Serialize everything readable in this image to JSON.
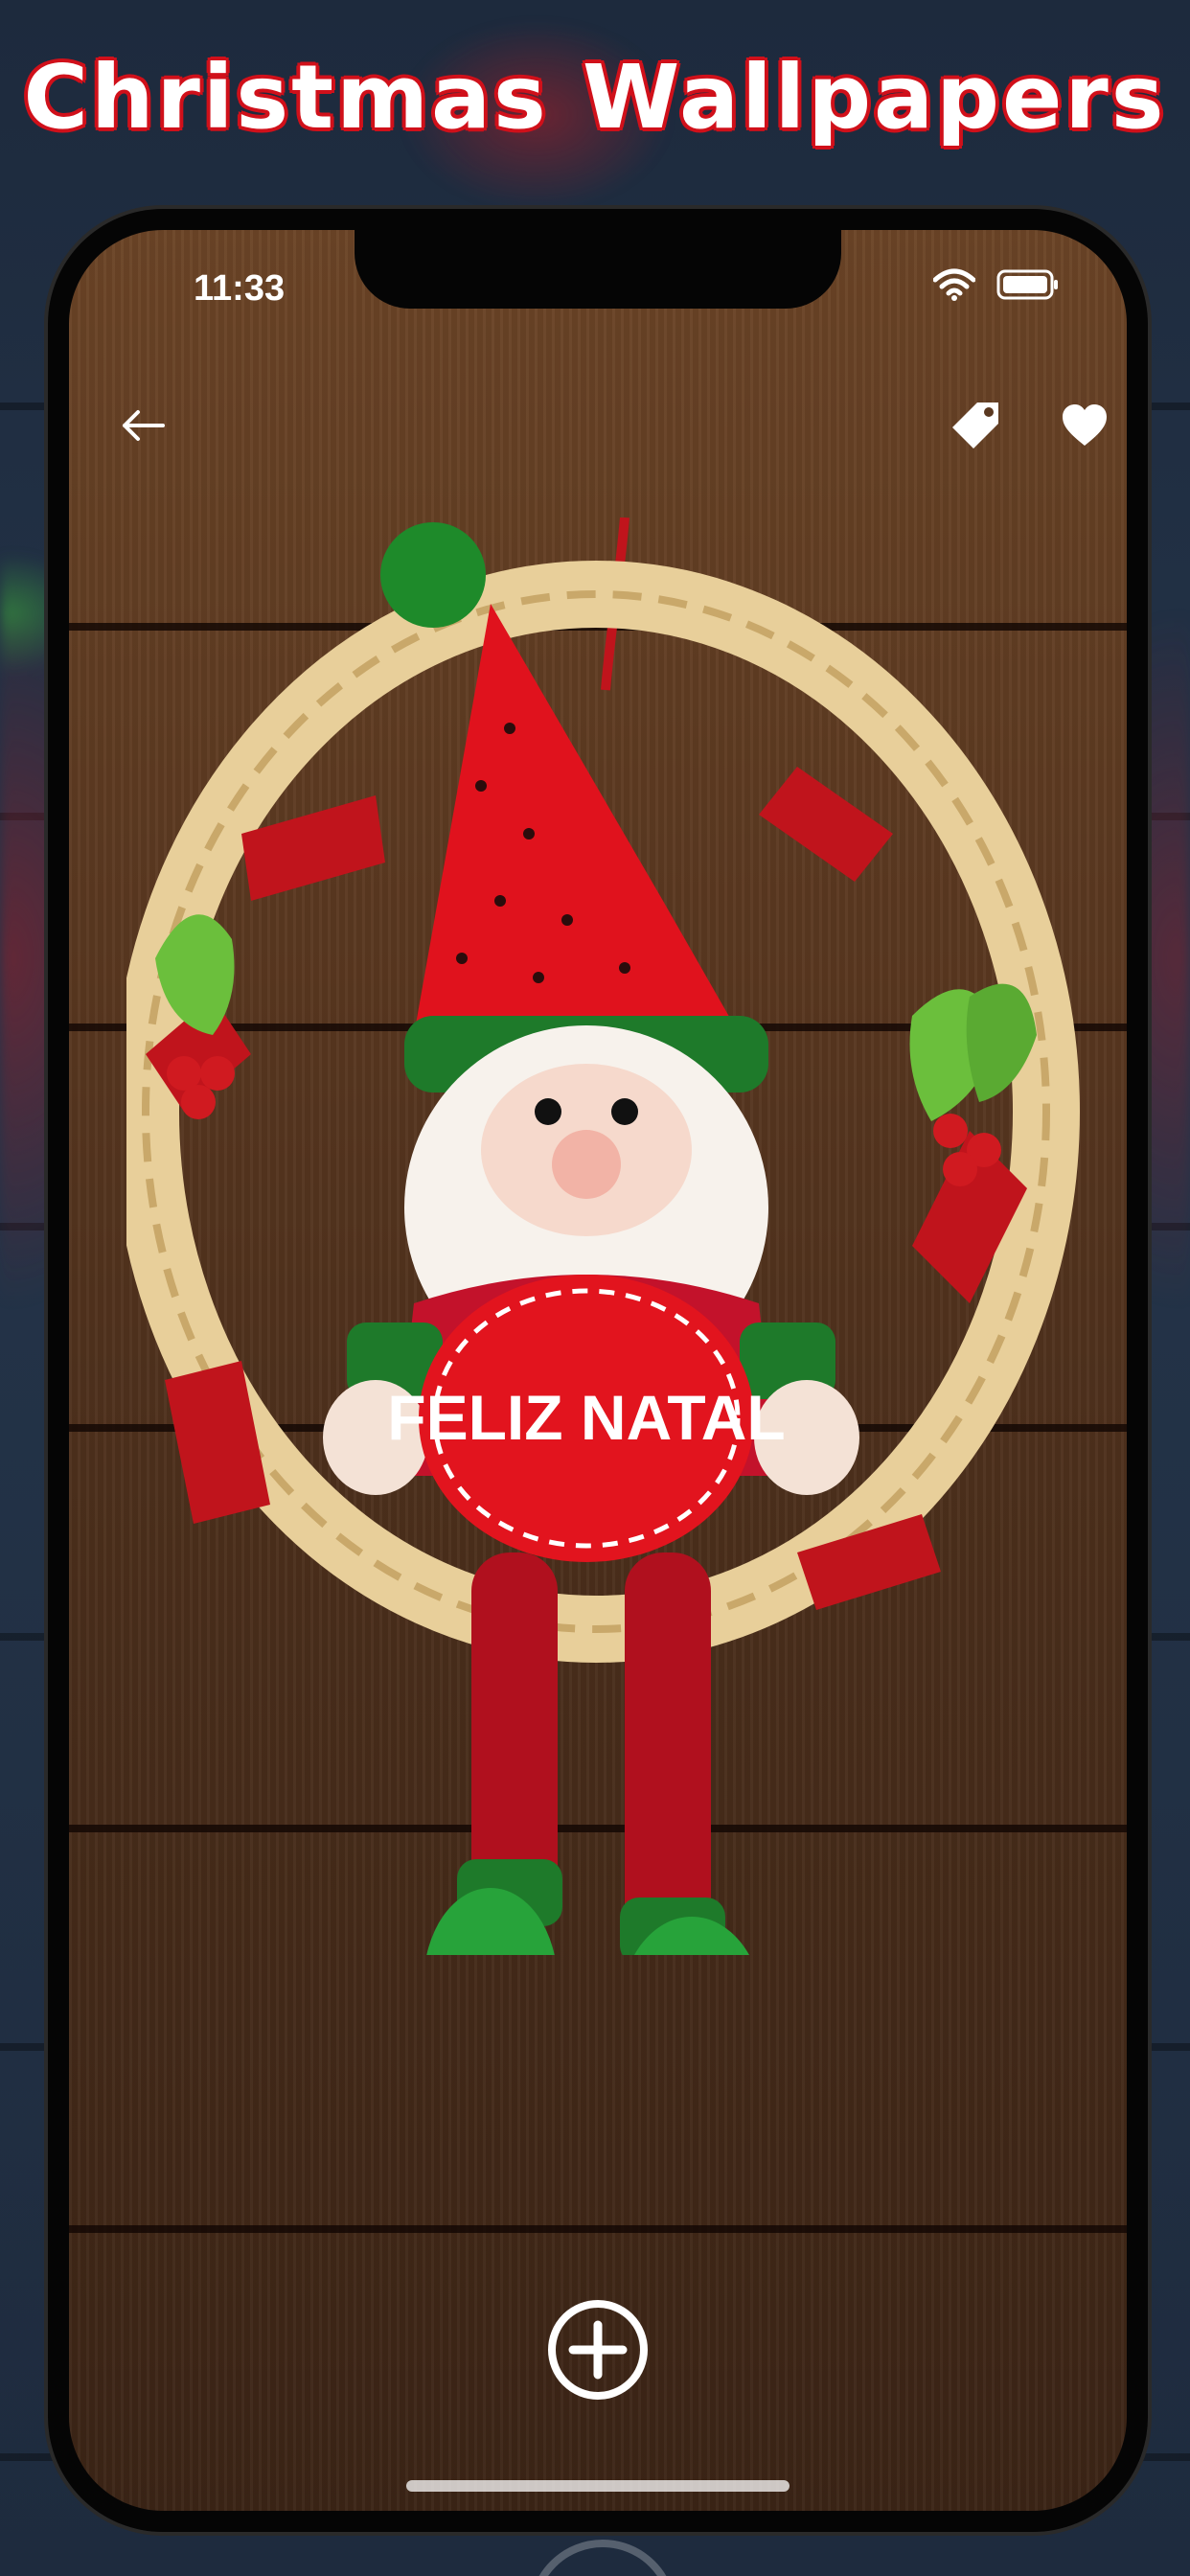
{
  "headline": "Christmas Wallpapers",
  "status_bar": {
    "time": "11:33",
    "icons": [
      "wifi-icon",
      "battery-icon"
    ]
  },
  "top_bar": {
    "back_icon": "arrow-left-icon",
    "actions": [
      "tag-icon",
      "heart-icon"
    ]
  },
  "wallpaper": {
    "sign_text": "FELIZ NATAL"
  },
  "bottom_bar": {
    "add_icon": "plus-circle-icon"
  },
  "colors": {
    "headline_outline": "#d0101a",
    "wood": "#5a3820",
    "backdrop": "#1e2b3e"
  }
}
